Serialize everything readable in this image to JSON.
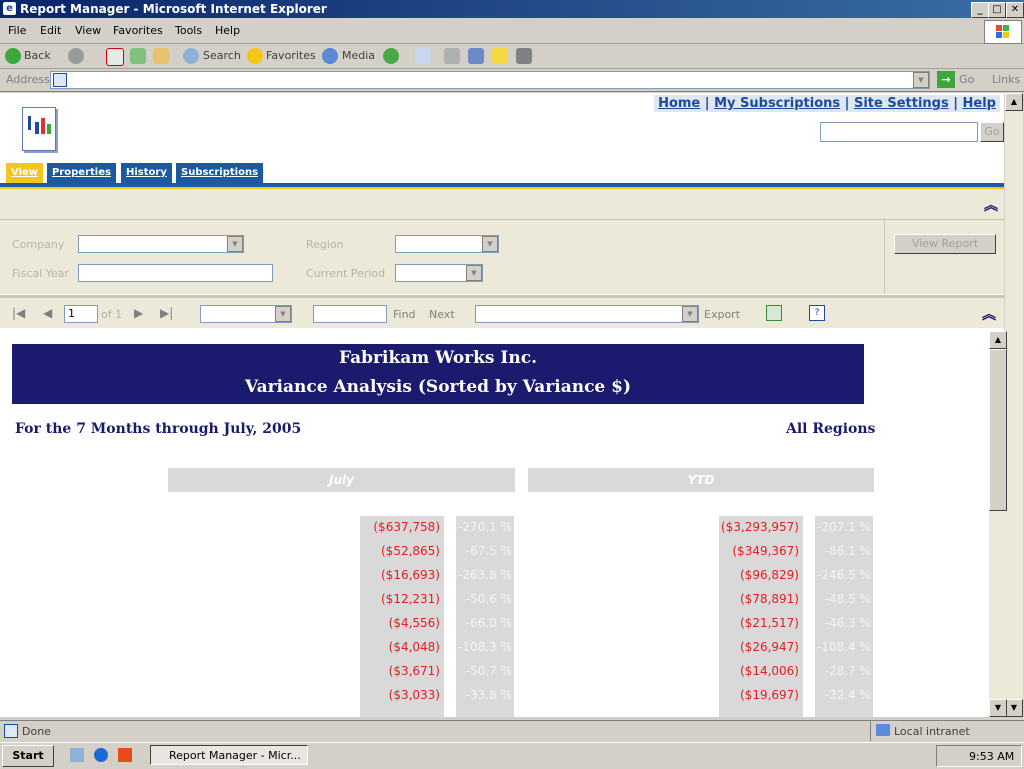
{
  "window": {
    "title": "Report Manager - Microsoft Internet Explorer"
  },
  "menu": [
    "File",
    "Edit",
    "View",
    "Favorites",
    "Tools",
    "Help"
  ],
  "toolbar": {
    "back": "Back",
    "search": "Search",
    "favorites": "Favorites",
    "media": "Media"
  },
  "address": {
    "label": "Address",
    "go": "Go",
    "links": "Links",
    "value": ""
  },
  "header_links": [
    "Home",
    "My Subscriptions",
    "Site Settings",
    "Help"
  ],
  "search": {
    "go": "Go",
    "value": ""
  },
  "tabs": [
    "View",
    "Properties",
    "History",
    "Subscriptions"
  ],
  "params": {
    "company_label": "Company",
    "region_label": "Region",
    "fiscal_year_label": "Fiscal Year",
    "current_period_label": "Current Period",
    "view_report": "View Report"
  },
  "report_toolbar": {
    "page": "1",
    "of": "of 1",
    "find": "Find",
    "next": "Next",
    "export": "Export"
  },
  "report": {
    "title1": "Fabrikam Works Inc.",
    "title2": "Variance Analysis (Sorted by Variance $)",
    "period": "For the 7 Months through July, 2005",
    "regions": "All Regions",
    "col_july": "July",
    "col_ytd": "YTD",
    "rows": [
      {
        "july": "($637,758)",
        "july_pct": "-270.1 %",
        "ytd": "($3,293,957)",
        "ytd_pct": "-207.1 %"
      },
      {
        "july": "($52,865)",
        "july_pct": "-67.5 %",
        "ytd": "($349,367)",
        "ytd_pct": "-86.1 %"
      },
      {
        "july": "($16,693)",
        "july_pct": "-263.8 %",
        "ytd": "($96,829)",
        "ytd_pct": "-246.5 %"
      },
      {
        "july": "($12,231)",
        "july_pct": "-50.6 %",
        "ytd": "($78,891)",
        "ytd_pct": "-48.5 %"
      },
      {
        "july": "($4,556)",
        "july_pct": "-66.0 %",
        "ytd": "($21,517)",
        "ytd_pct": "-46.3 %"
      },
      {
        "july": "($4,048)",
        "july_pct": "-108.3 %",
        "ytd": "($26,947)",
        "ytd_pct": "-108.4 %"
      },
      {
        "july": "($3,671)",
        "july_pct": "-50.7 %",
        "ytd": "($14,006)",
        "ytd_pct": "-28.7 %"
      },
      {
        "july": "($3,033)",
        "july_pct": "-33.8 %",
        "ytd": "($19,697)",
        "ytd_pct": "-32.4 %"
      }
    ]
  },
  "status": {
    "left": "Done",
    "zone": "Local intranet"
  },
  "taskbar": {
    "start": "Start",
    "task": "Report Manager - Micr...",
    "clock": "9:53 AM"
  }
}
